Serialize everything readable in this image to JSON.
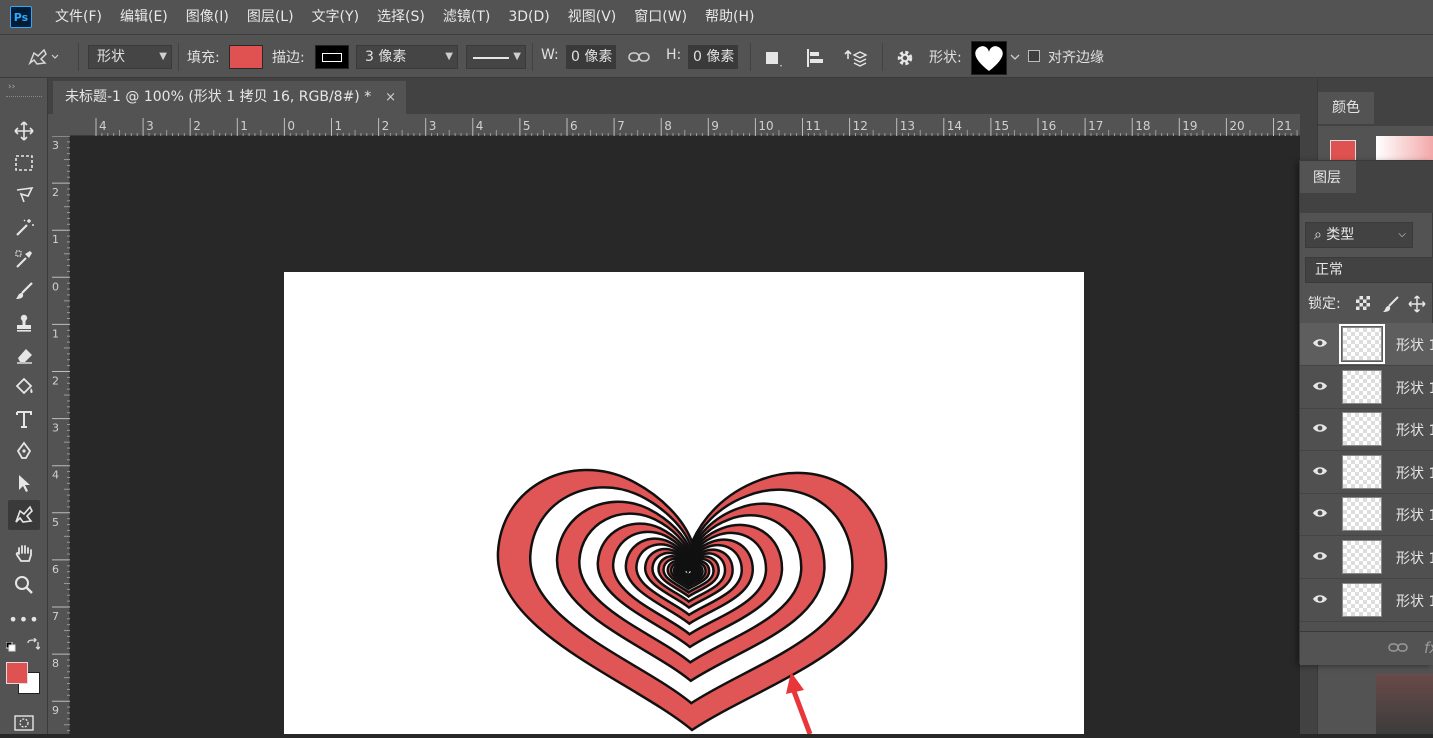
{
  "app": {
    "logo": "Ps"
  },
  "menu": [
    "文件(F)",
    "编辑(E)",
    "图像(I)",
    "图层(L)",
    "文字(Y)",
    "选择(S)",
    "滤镜(T)",
    "3D(D)",
    "视图(V)",
    "窗口(W)",
    "帮助(H)"
  ],
  "options": {
    "mode": "形状",
    "fill_label": "填充:",
    "fill_color": "#e05252",
    "stroke_label": "描边:",
    "stroke_width": "3 像素",
    "w_label": "W:",
    "w_value": "0 像素",
    "h_label": "H:",
    "h_value": "0 像素",
    "shape_label": "形状:",
    "align_edges_label": "对齐边缘"
  },
  "document": {
    "tab_title": "未标题-1 @ 100% (形状 1 拷贝 16, RGB/8#) *",
    "close": "×"
  },
  "rulers": {
    "horizontal": [
      "4",
      "3",
      "2",
      "1",
      "0",
      "1",
      "2",
      "3",
      "4",
      "5",
      "6",
      "7",
      "8",
      "9",
      "10",
      "11",
      "12",
      "13",
      "14",
      "15",
      "16",
      "17",
      "18",
      "19",
      "20",
      "21"
    ],
    "vertical": [
      "3",
      "2",
      "1",
      "0",
      "1",
      "2",
      "3",
      "4",
      "5",
      "6",
      "7",
      "8",
      "9"
    ]
  },
  "colors": {
    "foreground": "#e05252",
    "background": "#ffffff",
    "heart_red": "#e05555"
  },
  "color_panel": {
    "tab": "颜色"
  },
  "layers_panel": {
    "tab": "图层",
    "filter_label": "类型",
    "blend_mode": "正常",
    "lock_label": "锁定:",
    "layers": [
      {
        "name": "形状 1",
        "selected": true
      },
      {
        "name": "形状 1",
        "selected": false
      },
      {
        "name": "形状 1",
        "selected": false
      },
      {
        "name": "形状 1",
        "selected": false
      },
      {
        "name": "形状 1",
        "selected": false
      },
      {
        "name": "形状 1",
        "selected": false
      },
      {
        "name": "形状 1",
        "selected": false
      }
    ],
    "footer_fx": "fx"
  }
}
